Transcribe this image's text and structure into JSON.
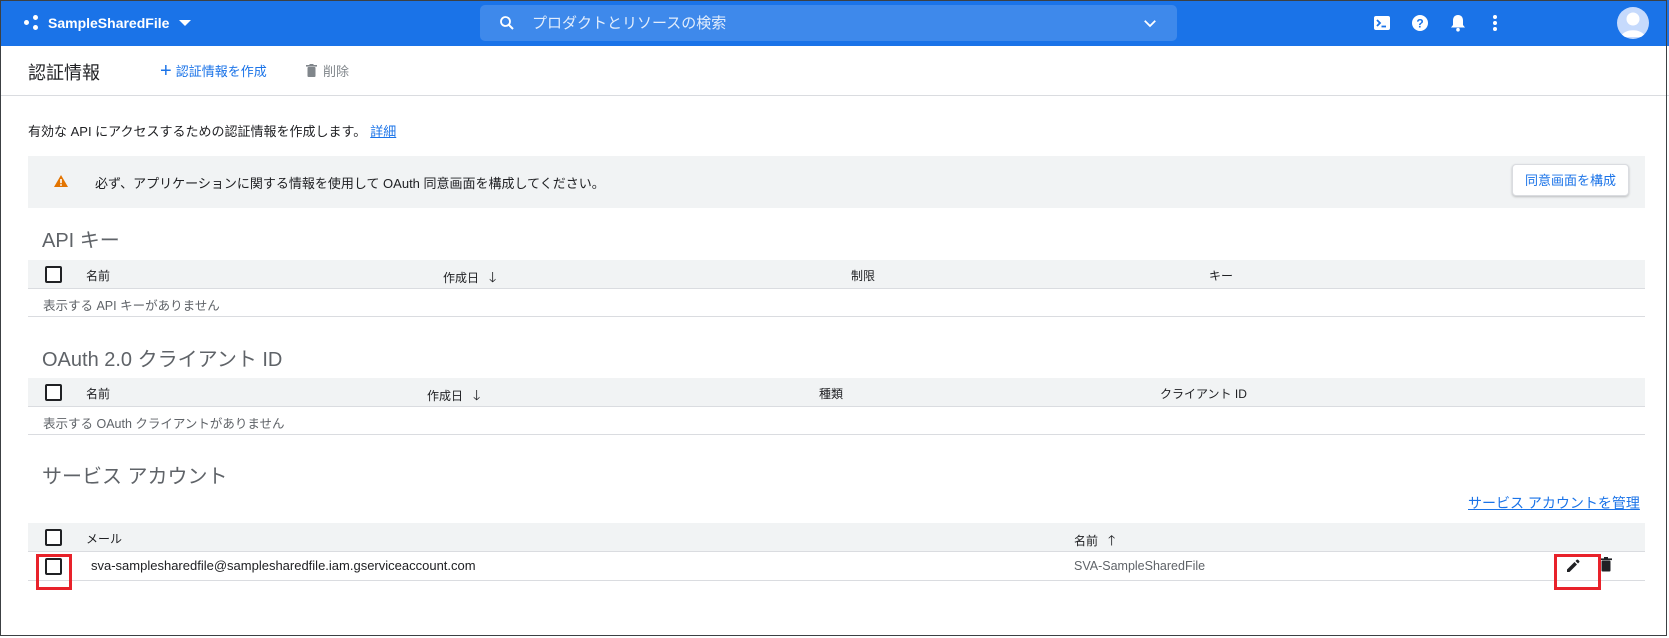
{
  "topbar": {
    "project_name": "SampleSharedFile",
    "search_placeholder": "プロダクトとリソースの検索"
  },
  "actionbar": {
    "title": "認証情報",
    "create_label": "認証情報を作成",
    "delete_label": "削除"
  },
  "intro": {
    "text": "有効な API にアクセスするための認証情報を作成します。",
    "link": "詳細"
  },
  "banner": {
    "message": "必ず、アプリケーションに関する情報を使用して OAuth 同意画面を構成してください。",
    "button": "同意画面を構成"
  },
  "api_keys": {
    "title": "API キー",
    "columns": [
      "名前",
      "作成日",
      "制限",
      "キー"
    ],
    "empty": "表示する API キーがありません"
  },
  "oauth": {
    "title": "OAuth 2.0 クライアント ID",
    "columns": [
      "名前",
      "作成日",
      "種類",
      "クライアント ID"
    ],
    "empty": "表示する OAuth クライアントがありません"
  },
  "service_accounts": {
    "title": "サービス アカウント",
    "manage_link": "サービス アカウントを管理",
    "columns": [
      "メール",
      "名前"
    ],
    "rows": [
      {
        "email": "sva-samplesharedfile@samplesharedfile.iam.gserviceaccount.com",
        "name": "SVA-SampleSharedFile"
      }
    ]
  },
  "colors": {
    "brand": "#1a73e8",
    "warning": "#e37400",
    "highlight": "#e8222a"
  }
}
